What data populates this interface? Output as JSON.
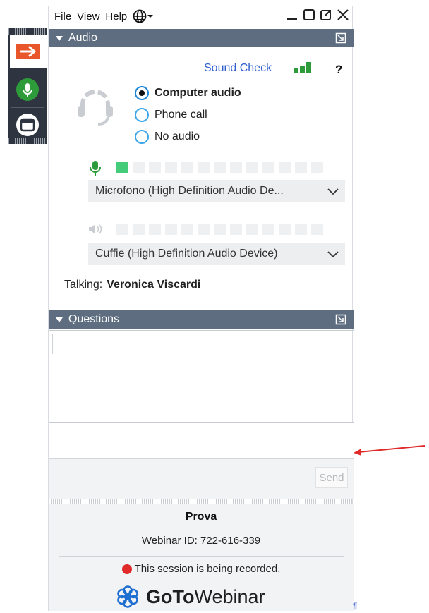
{
  "menubar": {
    "file": "File",
    "view": "View",
    "help": "Help"
  },
  "audio": {
    "header": "Audio",
    "sound_check": "Sound Check",
    "help_glyph": "?",
    "options": [
      {
        "label": "Computer audio",
        "selected": true
      },
      {
        "label": "Phone call",
        "selected": false
      },
      {
        "label": "No audio",
        "selected": false
      }
    ],
    "mic_level_segments_lit": 1,
    "mic_level_segments_total": 13,
    "speaker_level_segments_total": 13,
    "microphone_select": "Microfono (High Definition Audio De...",
    "speaker_select": "Cuffie (High Definition Audio Device)",
    "talking_label": "Talking:",
    "talking_name": "Veronica Viscardi"
  },
  "questions": {
    "header": "Questions",
    "send_label": "Send"
  },
  "footer": {
    "title": "Prova",
    "webinar_id": "Webinar ID: 722-616-339",
    "recording": "This session is being recorded.",
    "logo_goto": "GoTo",
    "logo_webinar": "Webinar"
  },
  "misc": {
    "pilcrow": "¶"
  },
  "colors": {
    "accent_orange": "#e8562a",
    "accent_green": "#2e9b3a",
    "section_bar": "#5e6e80",
    "link_blue": "#2f5fd0",
    "record_red": "#e02a2a"
  },
  "icons": [
    "arrow-right-icon",
    "microphone-icon",
    "window-icon",
    "globe-icon",
    "minimize-icon",
    "maximize-icon",
    "popout-icon",
    "close-icon",
    "headset-icon",
    "speaker-icon",
    "chevron-down-icon",
    "gotowebinar-logo-icon",
    "red-arrow-annotation"
  ]
}
